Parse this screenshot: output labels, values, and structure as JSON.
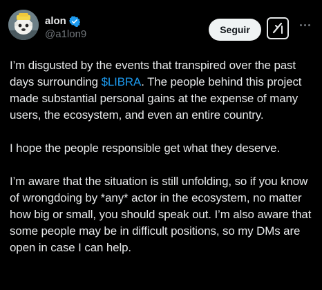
{
  "author": {
    "name": "alon",
    "handle": "@a1lon9",
    "verified_color": "#1d9bf0"
  },
  "actions": {
    "follow_label": "Seguir",
    "grok_icon": "grok-icon",
    "more_icon": "more-dots-icon"
  },
  "tweet": {
    "p1_before": "I’m disgusted by the events that transpired over the past days surrounding ",
    "p1_cashtag": "$LIBRA",
    "p1_after": ". The people behind this project made substantial personal gains at the expense of many users, the ecosystem, and even an entire country.",
    "p2": "I hope the people responsible get what they deserve.",
    "p3": "I’m aware that the situation is still unfolding, so if you know of wrongdoing by *any* actor in the ecosystem, no matter how big or small, you should speak out. I’m also aware that some people may be in difficult positions, so my DMs are open in case I can help."
  },
  "colors": {
    "background": "#000000",
    "text": "#e7e9ea",
    "secondary": "#71767b",
    "link": "#1d9bf0"
  }
}
